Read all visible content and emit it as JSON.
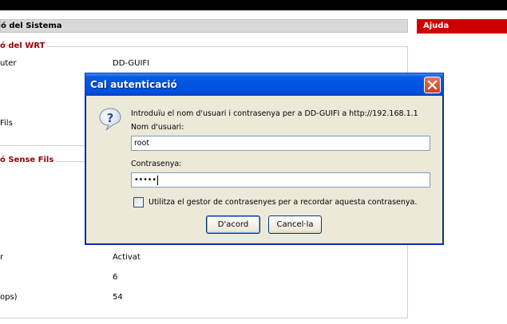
{
  "page": {
    "section_title": "ó del Sistema",
    "help_title": "Ajuda",
    "wrt_legend": "ó del WRT",
    "wireless_legend": "ó Sense Fils",
    "rows": [
      {
        "label": "uter",
        "value": "DD-GUIFI"
      },
      {
        "label": "Fils",
        "value": ""
      },
      {
        "label": "r",
        "value": "Activat"
      },
      {
        "label": "",
        "value": "6"
      },
      {
        "label": "ops)",
        "value": "54"
      }
    ]
  },
  "dialog": {
    "title": "Cal autenticació",
    "prompt": "Introduïu el nom d'usuari i contrasenya per a DD-GUIFI a http://192.168.1.1",
    "username_label": "Nom d'usuari:",
    "username_value": "root",
    "password_label": "Contrasenya:",
    "password_value": "•••••",
    "remember_label": "Utilitza el gestor de contrasenyes per a recordar aquesta contrasenya.",
    "remember_checked": false,
    "ok_label": "D'acord",
    "cancel_label": "Cancel·la"
  },
  "icons": {
    "close": "close-icon",
    "question": "question-icon"
  },
  "colors": {
    "titlebar": "#0054e3",
    "help_header": "#cc0000",
    "legend_text": "#990000"
  }
}
